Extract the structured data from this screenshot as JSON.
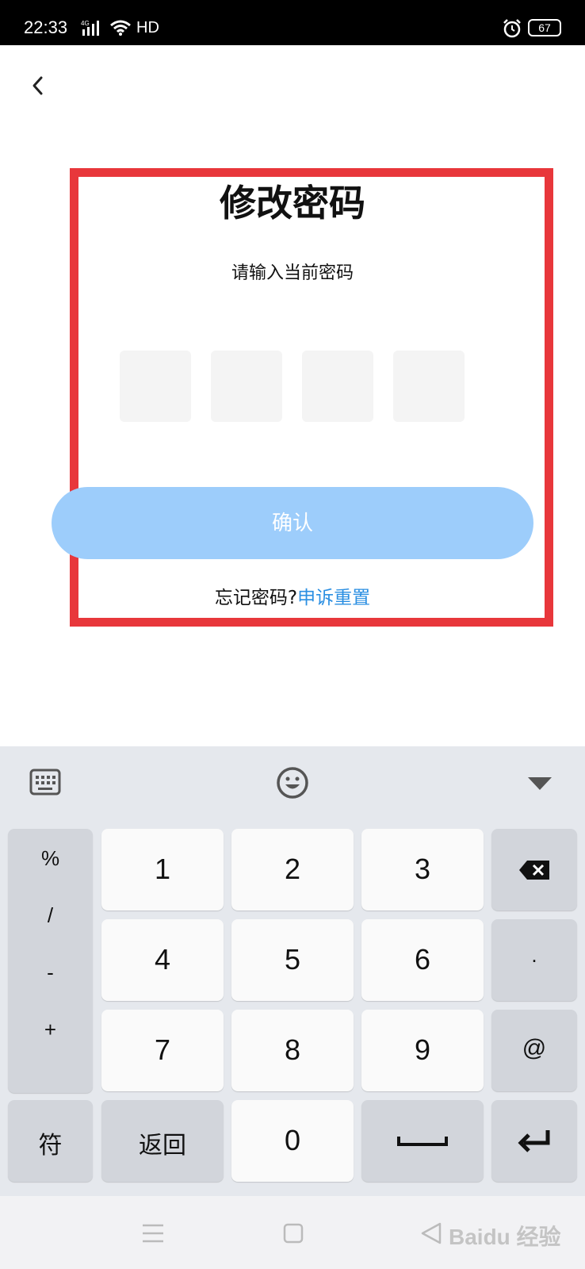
{
  "status_bar": {
    "time": "22:33",
    "network": "4G",
    "hd": "HD",
    "battery": "67",
    "icons": [
      "signal-icon",
      "wifi-icon",
      "alarm-icon",
      "battery-icon"
    ]
  },
  "page": {
    "title": "修改密码",
    "prompt": "请输入当前密码",
    "pin_length": 4,
    "confirm_label": "确认",
    "forgot_text": "忘记密码?",
    "reset_link": "申诉重置",
    "highlight_color": "#e8373b",
    "accent_color": "#2b8fe2",
    "button_color": "#9dcdfb"
  },
  "keyboard": {
    "toolbar_icons": [
      "keyboard-icon",
      "emoji-icon",
      "collapse-icon"
    ],
    "symbols": [
      "%",
      "/",
      "-",
      "+"
    ],
    "digits_row1": [
      "1",
      "2",
      "3"
    ],
    "digits_row2": [
      "4",
      "5",
      "6"
    ],
    "digits_row3": [
      "7",
      "8",
      "9"
    ],
    "dot": ".",
    "at": "@",
    "symbol_key": "符",
    "back_key": "返回",
    "zero": "0"
  },
  "nav_bar": {
    "icons": [
      "menu-icon",
      "home-icon",
      "back-icon"
    ]
  },
  "watermark": "Baidu 经验"
}
